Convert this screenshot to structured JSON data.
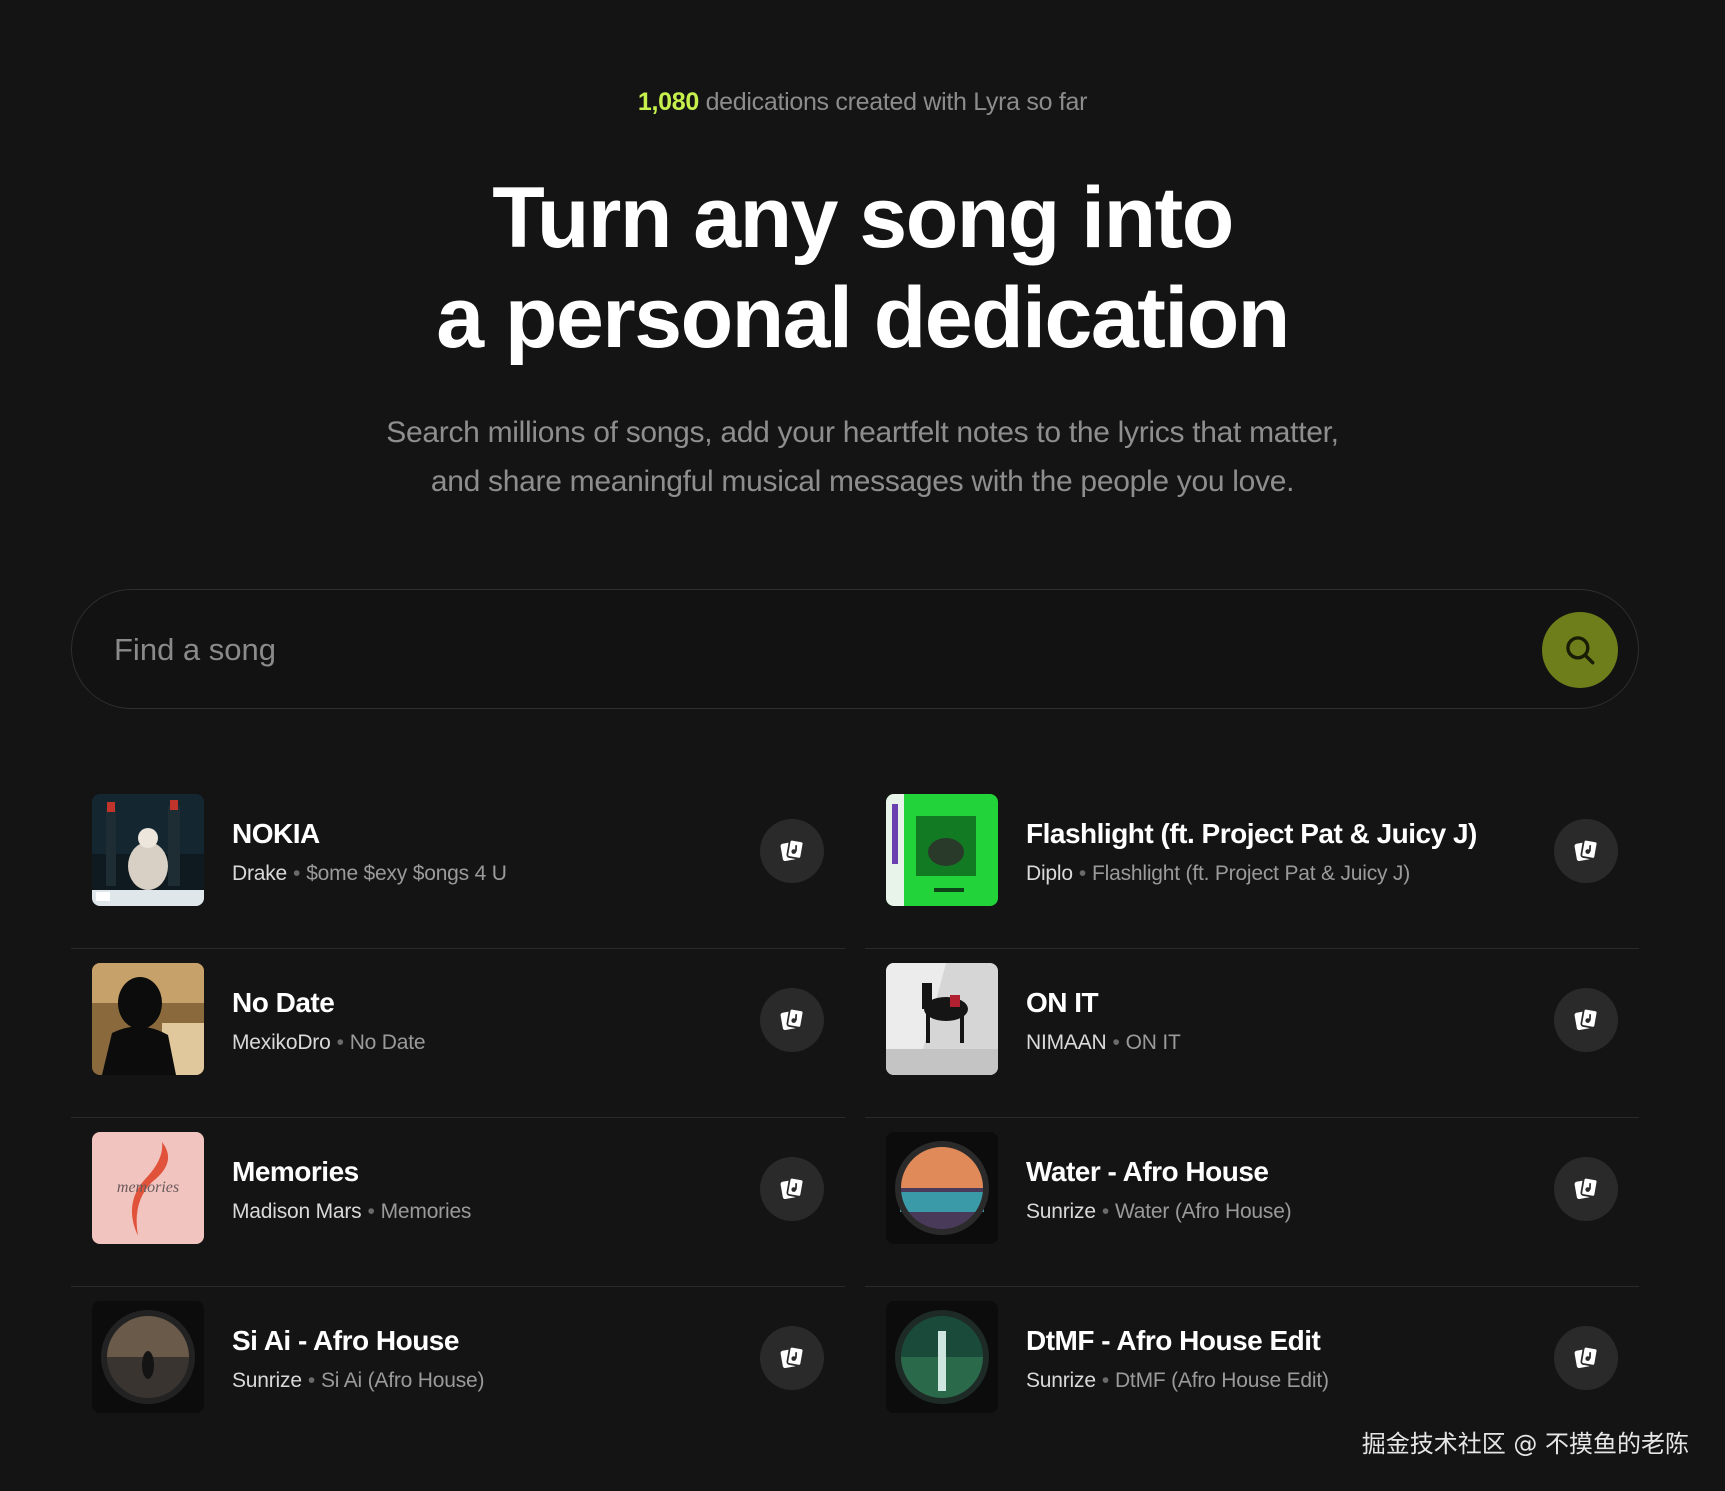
{
  "counter": {
    "number": "1,080",
    "text": " dedications created with Lyra so far"
  },
  "hero": {
    "line1": "Turn any song into",
    "line2": "a personal dedication",
    "sub1": "Search millions of songs, add your heartfelt notes to the lyrics that matter,",
    "sub2": "and share meaningful musical messages with the people you love."
  },
  "search": {
    "placeholder": "Find a song",
    "value": "",
    "button_icon": "search-icon"
  },
  "songs": [
    {
      "title": "NOKIA",
      "artist": "Drake",
      "album": "$ome $exy $ongs 4 U"
    },
    {
      "title": "Flashlight (ft. Project Pat & Juicy J)",
      "artist": "Diplo",
      "album": "Flashlight (ft. Project Pat & Juicy J)"
    },
    {
      "title": "No Date",
      "artist": "MexikoDro",
      "album": "No Date"
    },
    {
      "title": "ON IT",
      "artist": "NIMAAN",
      "album": "ON IT"
    },
    {
      "title": "Memories",
      "artist": "Madison Mars",
      "album": "Memories",
      "art_text": "memories"
    },
    {
      "title": "Water - Afro House",
      "artist": "Sunrize",
      "album": "Water (Afro House)"
    },
    {
      "title": "Si Ai - Afro House",
      "artist": "Sunrize",
      "album": "Si Ai (Afro House)"
    },
    {
      "title": "DtMF - Afro House Edit",
      "artist": "Sunrize",
      "album": "DtMF (Afro House Edit)"
    }
  ],
  "song_separator": "•",
  "dedicate_icon": "dedicate-note-icon",
  "watermark": "掘金技术社区 @ 不摸鱼的老陈",
  "colors": {
    "background": "#141414",
    "accent": "#c6f04c",
    "search_button": "#6e7e1a"
  }
}
